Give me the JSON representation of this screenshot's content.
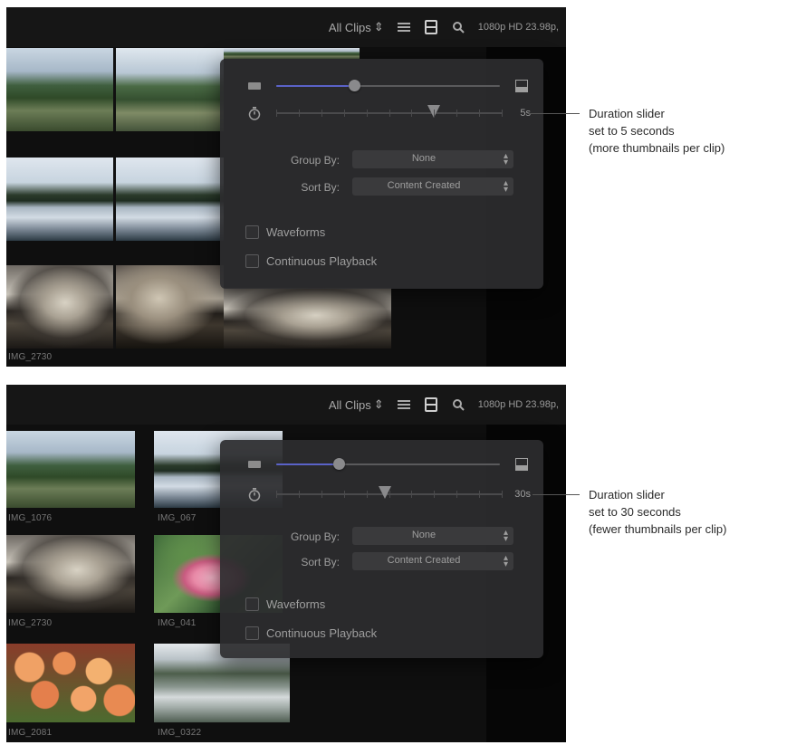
{
  "panels": [
    {
      "toolbar": {
        "clips_label": "All Clips",
        "clips_arrows": "⇕",
        "format": "1080p HD 23.98p,"
      },
      "clip_labels": [
        "IMG_2730"
      ],
      "popover": {
        "duration_value": "5s",
        "clip_height_level": 0.35,
        "duration_level": 0.7,
        "group_by": {
          "label": "Group By:",
          "value": "None"
        },
        "sort_by": {
          "label": "Sort By:",
          "value": "Content Created"
        },
        "waveforms": {
          "label": "Waveforms",
          "checked": false
        },
        "continuous_playback": {
          "label": "Continuous Playback",
          "checked": false
        }
      },
      "callout": [
        "Duration slider",
        "set to 5 seconds",
        "(more thumbnails per clip)"
      ]
    },
    {
      "toolbar": {
        "clips_label": "All Clips",
        "clips_arrows": "⇕",
        "format": "1080p HD 23.98p,"
      },
      "clip_labels": [
        "IMG_1076",
        "IMG_067",
        "IMG_2730",
        "IMG_041",
        "IMG_2081",
        "IMG_0322"
      ],
      "popover": {
        "duration_value": "30s",
        "clip_height_level": 0.28,
        "duration_level": 0.48,
        "group_by": {
          "label": "Group By:",
          "value": "None"
        },
        "sort_by": {
          "label": "Sort By:",
          "value": "Content Created"
        },
        "waveforms": {
          "label": "Waveforms",
          "checked": false
        },
        "continuous_playback": {
          "label": "Continuous Playback",
          "checked": false
        }
      },
      "callout": [
        "Duration slider",
        "set to 30 seconds",
        "(fewer thumbnails per clip)"
      ]
    }
  ]
}
